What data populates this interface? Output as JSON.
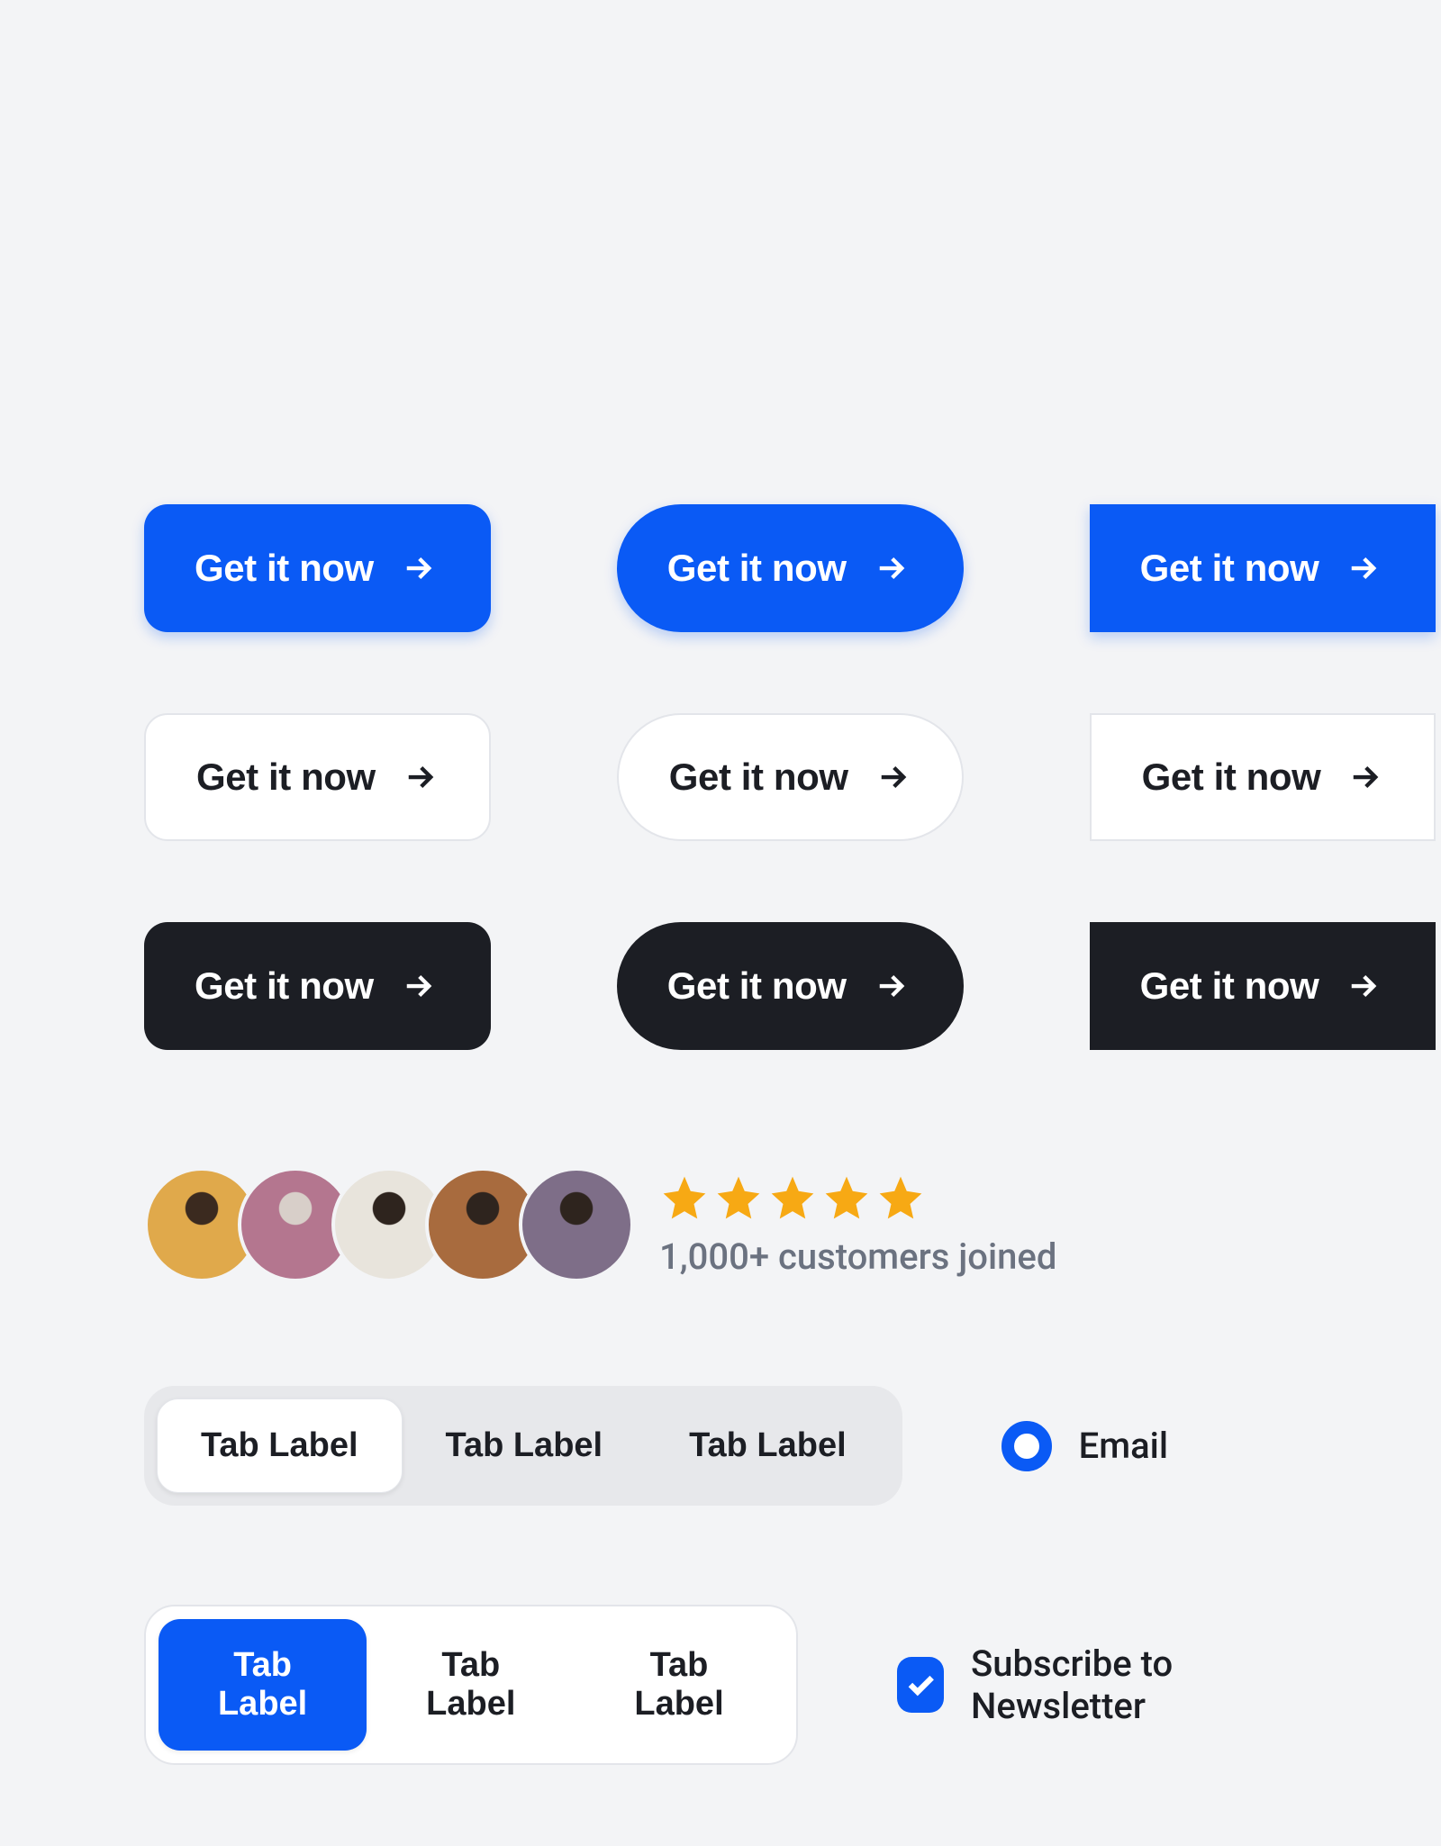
{
  "buttons": {
    "label": "Get it now"
  },
  "social": {
    "stars": 5,
    "text": "1,000+ customers joined"
  },
  "avatars": {
    "colors": [
      "#e0a94b",
      "#b4768f",
      "#e8e4dc",
      "#a86b3e",
      "#7e6e88"
    ]
  },
  "tabs": {
    "group1": [
      "Tab Label",
      "Tab Label",
      "Tab Label"
    ],
    "group2": [
      "Tab Label",
      "Tab Label",
      "Tab Label"
    ]
  },
  "radio": {
    "label": "Email"
  },
  "checkbox": {
    "label": "Subscribe to Newsletter"
  }
}
